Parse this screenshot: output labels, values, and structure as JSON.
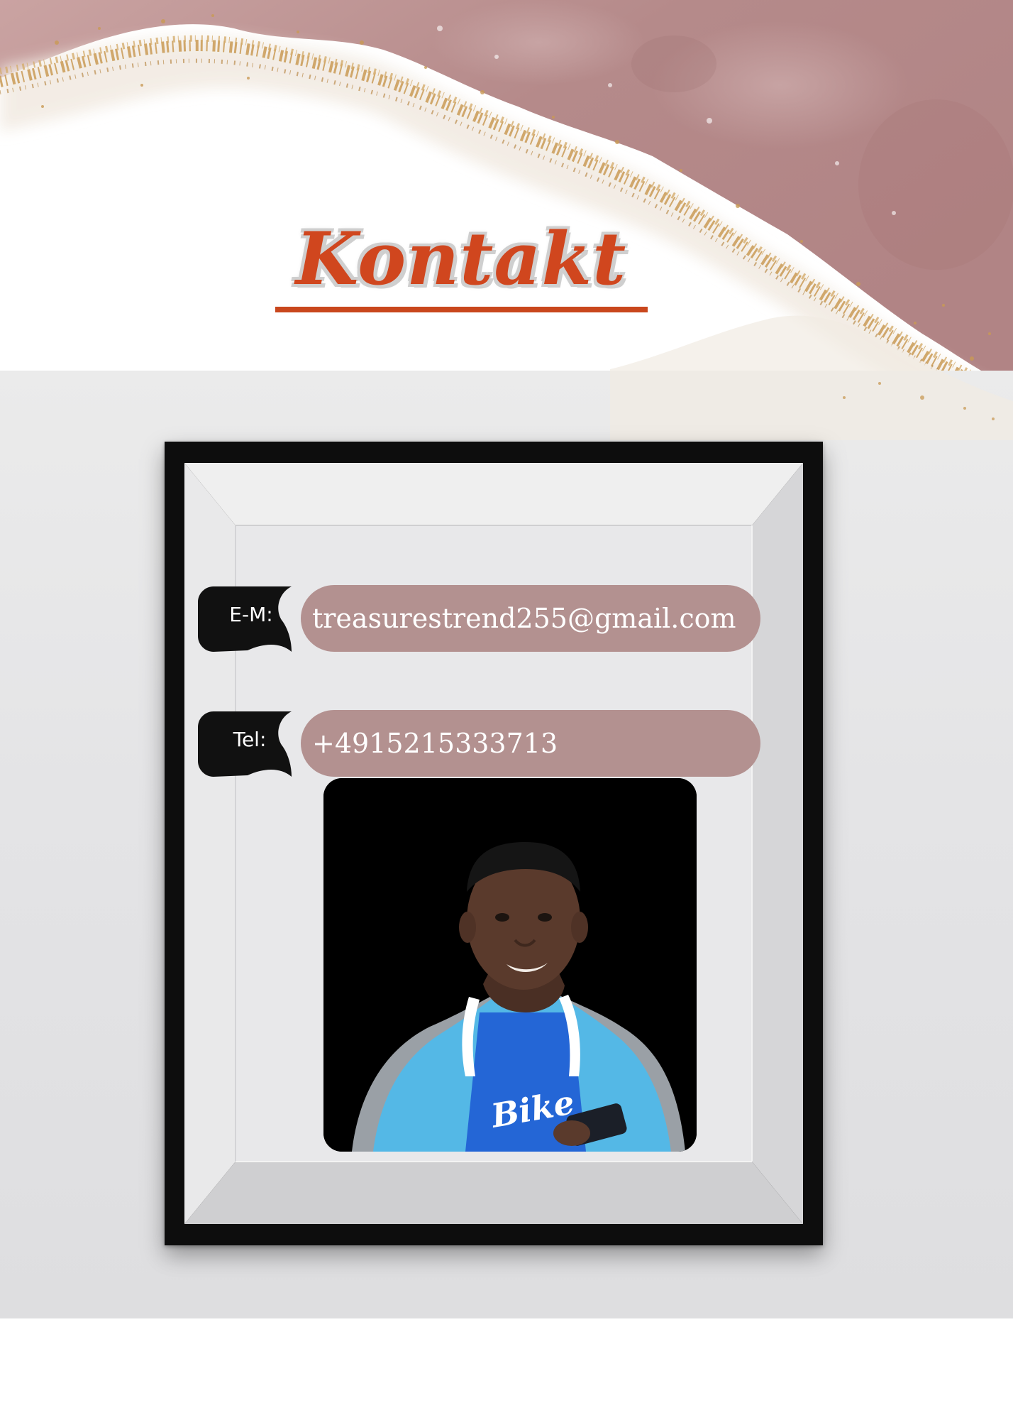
{
  "page": {
    "title": "Kontakt"
  },
  "contact": {
    "email_label": "E-M:",
    "email_value": "treasurestrend255@gmail.com",
    "phone_label": "Tel:",
    "phone_value": "+4915215333713"
  },
  "photo": {
    "shirt_text": "Bike"
  },
  "colors": {
    "title": "#d0461e",
    "pill": "#b39190",
    "tag": "#111111",
    "frame": "#0d0d0d",
    "banner_pink": "#b58a8a",
    "gold": "#c99a55",
    "jacket": "#54b8e6"
  }
}
